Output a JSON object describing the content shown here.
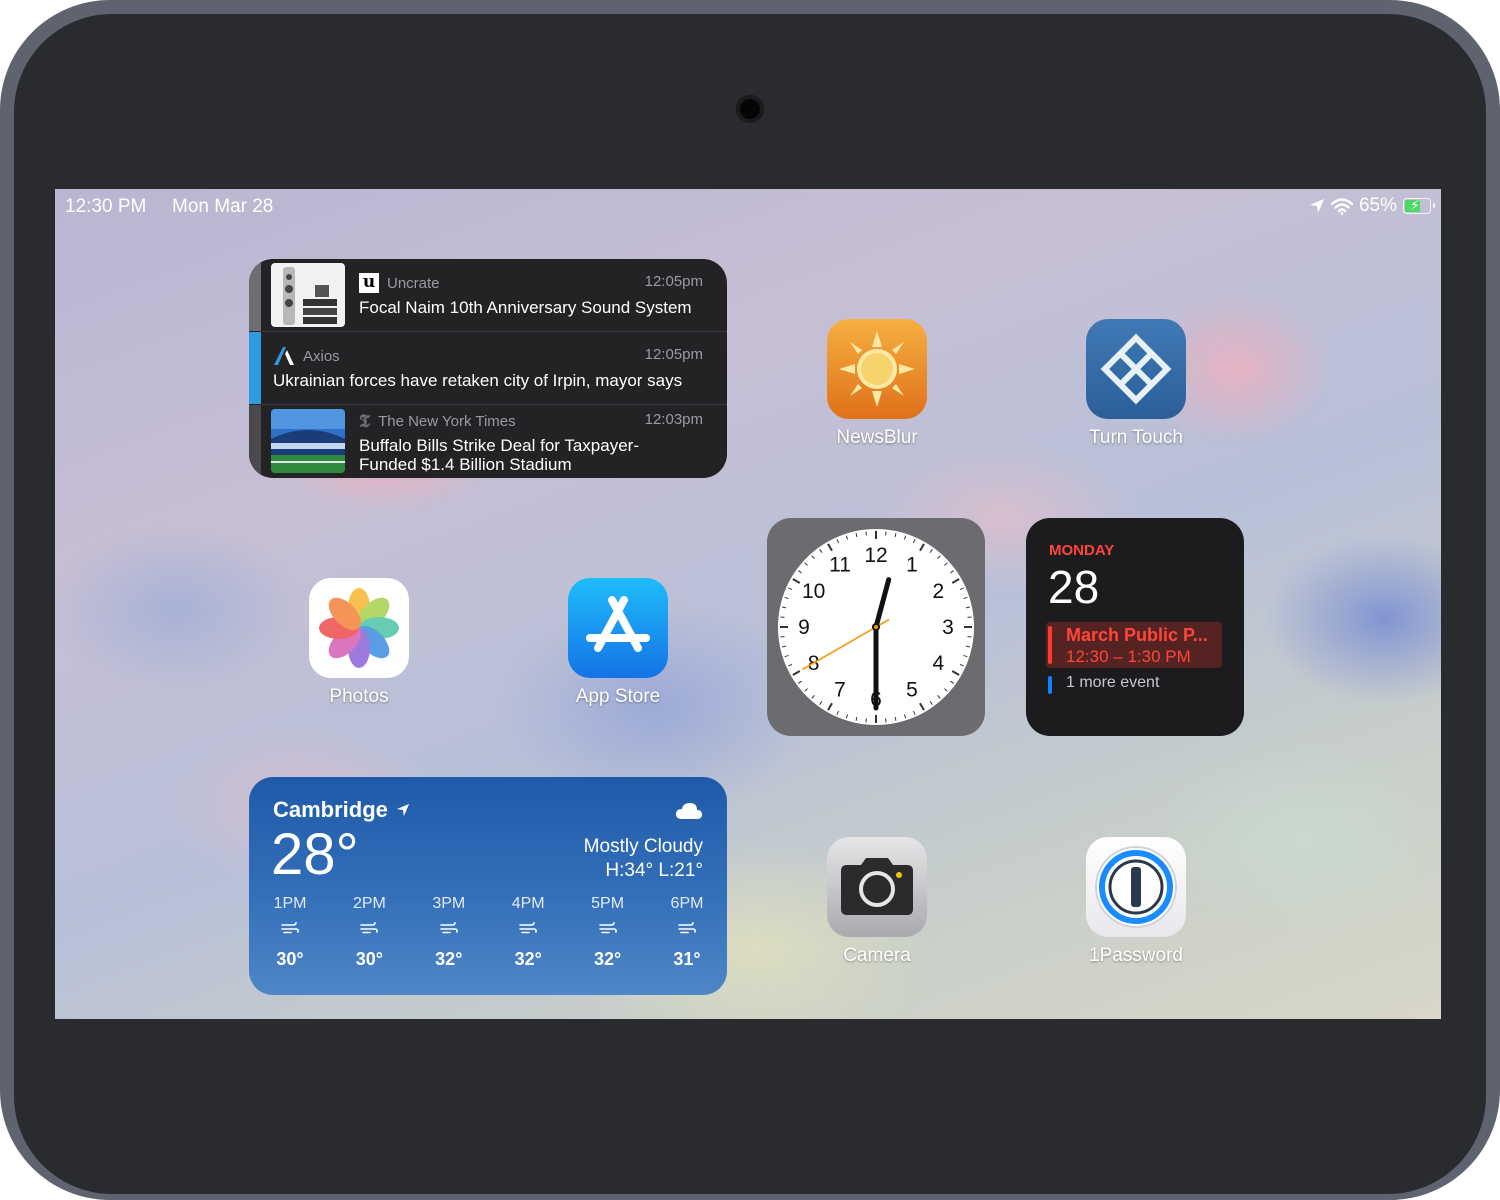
{
  "status_bar": {
    "time": "12:30 PM",
    "date": "Mon Mar 28",
    "battery": "65%",
    "battery_level": 0.65
  },
  "news_widget": {
    "items": [
      {
        "source": "Uncrate",
        "time": "12:05pm",
        "title": "Focal Naim 10th Anniversary Sound System",
        "accent": "#6d6d72"
      },
      {
        "source": "Axios",
        "time": "12:05pm",
        "title": "Ukrainian forces have retaken city of Irpin, mayor says",
        "accent": "#2f9ae0"
      },
      {
        "source": "The New York Times",
        "time": "12:03pm",
        "title_line1": "Buffalo Bills Strike Deal for Taxpayer-",
        "title_line2": "Funded $1.4 Billion Stadium",
        "accent": "#4a4a4e"
      }
    ]
  },
  "apps": {
    "newsblur": "NewsBlur",
    "turn_touch": "Turn Touch",
    "photos": "Photos",
    "app_store": "App Store",
    "camera": "Camera",
    "onepassword": "1Password"
  },
  "clock_widget": {
    "numbers": [
      "12",
      "1",
      "2",
      "3",
      "4",
      "5",
      "6",
      "7",
      "8",
      "9",
      "10",
      "11"
    ],
    "time": "12:30",
    "hour": 12,
    "minute": 30,
    "second": 40
  },
  "calendar_widget": {
    "weekday": "MONDAY",
    "day": "28",
    "event_title": "March Public P...",
    "event_time": "12:30 – 1:30 PM",
    "more": "1 more event",
    "event_color": "#ff3b30",
    "more_color": "#0a84ff"
  },
  "weather_widget": {
    "city": "Cambridge",
    "temp": "28°",
    "condition": "Mostly Cloudy",
    "hilo": "H:34° L:21°",
    "hours": [
      "1PM",
      "2PM",
      "3PM",
      "4PM",
      "5PM",
      "6PM"
    ],
    "temps": [
      "30°",
      "30°",
      "32°",
      "32°",
      "32°",
      "31°"
    ]
  }
}
